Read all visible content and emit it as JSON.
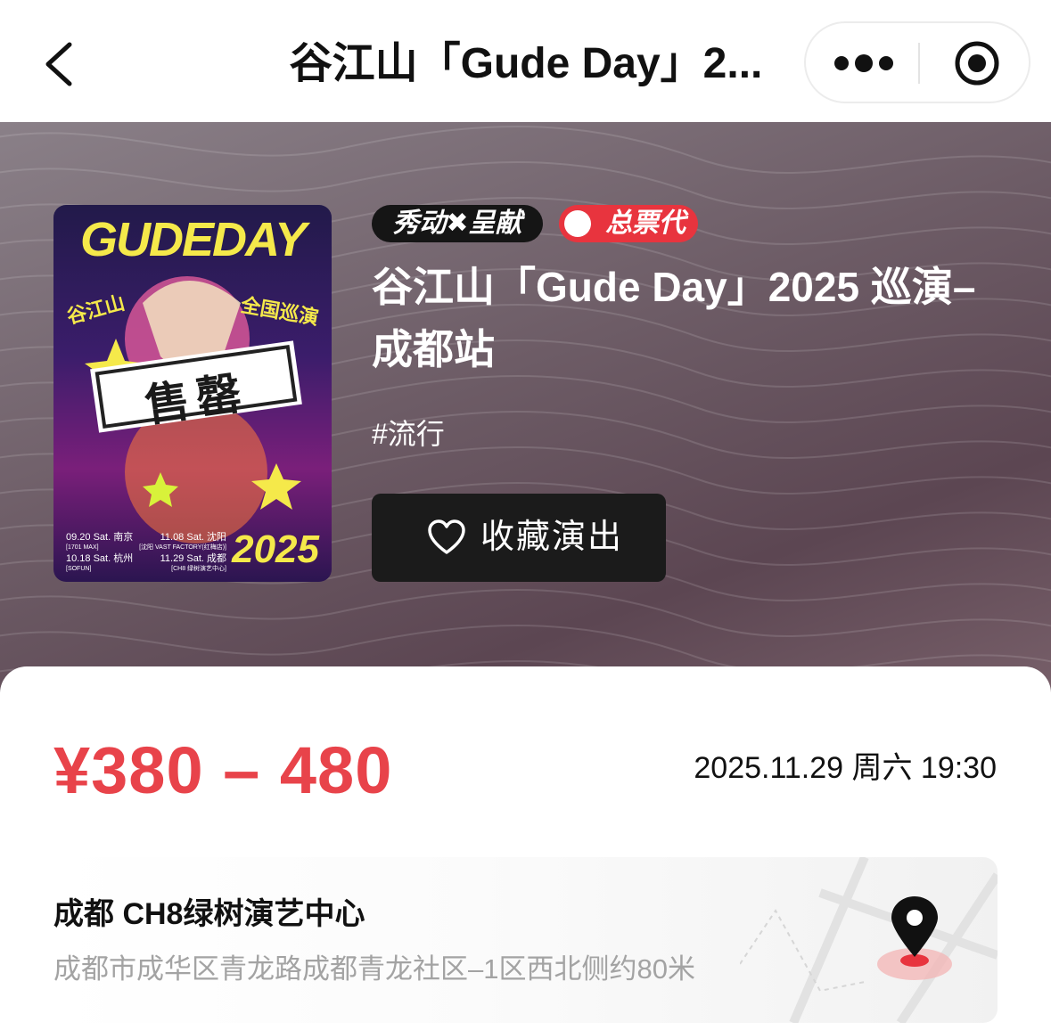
{
  "nav": {
    "title": "谷江山「Gude Day」2...",
    "back_icon": "chevron-left-icon",
    "more_icon": "more-dots-icon",
    "close_icon": "target-circle-icon"
  },
  "hero": {
    "badges": {
      "show": "秀动✖呈献",
      "ticket": "总票代"
    },
    "title": "谷江山「Gude Day」2025 巡演–成都站",
    "tag": "#流行",
    "favorite_label": "收藏演出",
    "favorite_icon": "heart-outline-icon",
    "poster": {
      "headline": "GUDEDAY",
      "artist": "谷江山",
      "tour": "全国巡演",
      "stamp": "售罄",
      "year": "2025",
      "dates": [
        {
          "date": "09.20 Sat.",
          "city": "南京",
          "venue": "[1701 MAX]"
        },
        {
          "date": "11.08 Sat.",
          "city": "沈阳",
          "venue": "[沈阳 VAST FACTORY(红梅店)]"
        },
        {
          "date": "10.18 Sat.",
          "city": "杭州",
          "venue": "[SOFUN]"
        },
        {
          "date": "11.29 Sat.",
          "city": "成都",
          "venue": "[CH8 绿树演艺中心]"
        }
      ]
    }
  },
  "detail": {
    "price": "¥380 – 480",
    "datetime": "2025.11.29 周六 19:30",
    "venue_name": "成都 CH8绿树演艺中心",
    "venue_address": "成都市成华区青龙路成都青龙社区–1区西北侧约80米",
    "map_icon": "location-pin-icon"
  },
  "colors": {
    "price": "#e8434a",
    "hero_bg": "#6d5c66",
    "button_bg": "#1b1b1b",
    "ticket_badge": "#e8343e"
  }
}
